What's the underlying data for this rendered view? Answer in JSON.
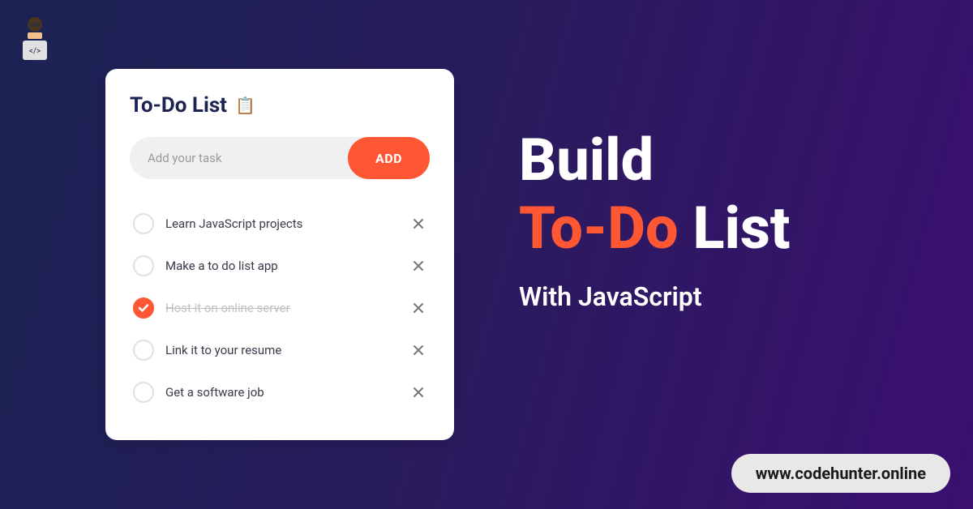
{
  "logo": {
    "alt": "codehunter-logo"
  },
  "card": {
    "title": "To-Do List",
    "icon": "📋",
    "input": {
      "placeholder": "Add your task",
      "value": ""
    },
    "addButton": "ADD",
    "tasks": [
      {
        "text": "Learn JavaScript projects",
        "done": false
      },
      {
        "text": "Make a to do list app",
        "done": false
      },
      {
        "text": "Host it on online server",
        "done": true
      },
      {
        "text": "Link it to your resume",
        "done": false
      },
      {
        "text": "Get a software job",
        "done": false
      }
    ]
  },
  "hero": {
    "line1": "Build",
    "line2_accent": "To-Do",
    "line2_rest": "List",
    "subtitle": "With JavaScript"
  },
  "siteUrl": "www.codehunter.online",
  "colors": {
    "accent": "#ff5733",
    "bgStart": "#1a2352",
    "bgEnd": "#3b1070"
  }
}
